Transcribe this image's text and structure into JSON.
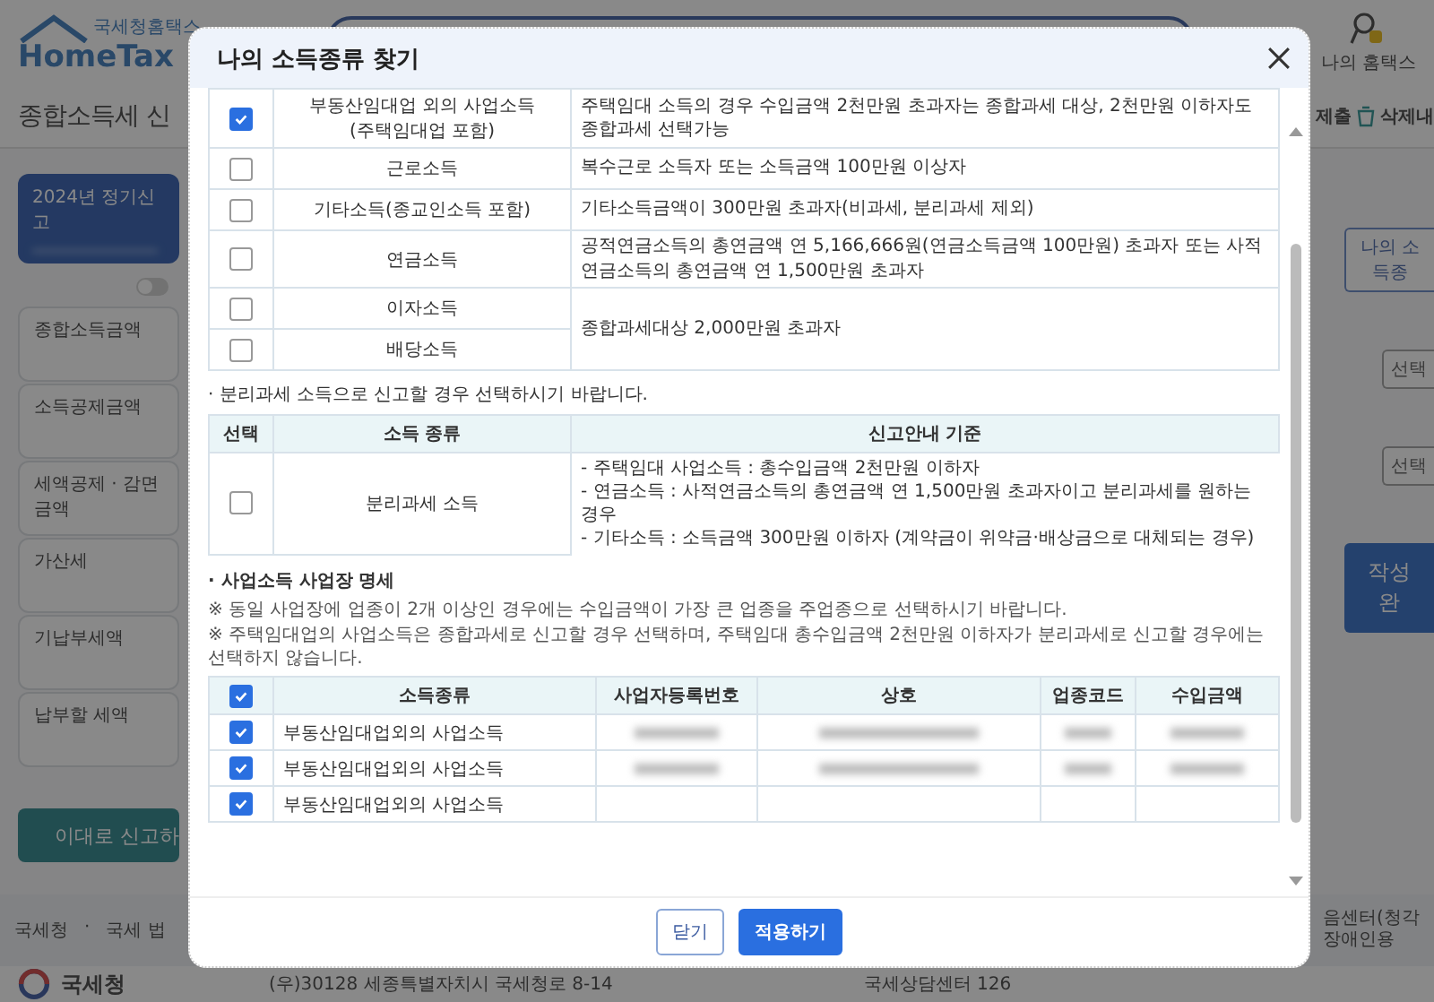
{
  "background_page": {
    "logo": {
      "small_text": "국세청홈택스",
      "brand": "HomeTax"
    },
    "user_menu": {
      "label": "나의 홈택스"
    },
    "page_title": "종합소득세 신",
    "toolbar": [
      "제출",
      "삭제내"
    ],
    "filing_card": {
      "label": "2024년 정기신고"
    },
    "toggle_on": false,
    "summary_items": [
      "종합소득금액",
      "소득공제금액",
      "세액공제 · 감면금액",
      "가산세",
      "기납부세액",
      "납부할 세액"
    ],
    "report_button": "이대로 신고하",
    "find_income_button": "나의 소득종",
    "select_buttons": [
      "선택",
      "선택"
    ],
    "complete_button": "작성완",
    "footer_links": [
      "국세청",
      "·",
      "국세 법"
    ],
    "footer_right": "음센터(청각장애인용",
    "address": "(우)30128 세종특별자치시 국세청로 8-14",
    "call_center": "국세상담센터 126",
    "agency_logo": "국세청"
  },
  "modal": {
    "title": "나의 소득종류 찾기",
    "income_groups": [
      {
        "description": "주택임대 소득의 경우 수입금액 2천만원 초과자는 종합과세 대상, 2천만원 이하자도 종합과세 선택가능",
        "items": [
          {
            "type": "부동산임대업 외의 사업소득\n(주택임대업 포함)",
            "checked": true
          }
        ]
      },
      {
        "description": "복수근로 소득자 또는 소득금액 100만원 이상자",
        "items": [
          {
            "type": "근로소득",
            "checked": false
          }
        ]
      },
      {
        "description": "기타소득금액이 300만원 초과자(비과세, 분리과세 제외)",
        "items": [
          {
            "type": "기타소득(종교인소득 포함)",
            "checked": false
          }
        ]
      },
      {
        "description": "공적연금소득의 총연금액 연 5,166,666원(연금소득금액 100만원) 초과자 또는 사적연금소득의 총연금액 연 1,500만원 초과자",
        "items": [
          {
            "type": "연금소득",
            "checked": false
          }
        ]
      },
      {
        "description": "종합과세대상 2,000만원 초과자",
        "items": [
          {
            "type": "이자소득",
            "checked": false
          },
          {
            "type": "배당소득",
            "checked": false
          }
        ]
      }
    ],
    "separate_note": "· 분리과세 소득으로 신고할 경우 선택하시기 바랍니다.",
    "separate_table": {
      "columns": [
        "선택",
        "소득 종류",
        "신고안내 기준"
      ],
      "rows": [
        {
          "checked": false,
          "type": "분리과세 소득",
          "criteria": [
            "- 주택임대 사업소득 : 총수입금액 2천만원 이하자",
            "- 연금소득 : 사적연금소득의 총연금액 연 1,500만원 초과자이고 분리과세를 원하는 경우",
            "- 기타소득 : 소득금액 300만원 이하자 (계약금이 위약금·배상금으로 대체되는 경우)"
          ]
        }
      ]
    },
    "business_heading": "· 사업소득 사업장 명세",
    "business_notes": [
      "※ 동일 사업장에 업종이 2개 이상인 경우에는 수입금액이 가장 큰 업종을 주업종으로 선택하시기 바랍니다.",
      "※ 주택임대업의 사업소득은 종합과세로 신고할 경우 선택하며, 주택임대 총수입금액 2천만원 이하자가 분리과세로 신고할 경우에는 선택하지 않습니다."
    ],
    "business_table": {
      "all_checked": true,
      "columns": [
        "소득종류",
        "사업자등록번호",
        "상호",
        "업종코드",
        "수입금액"
      ],
      "rows": [
        {
          "checked": true,
          "type": "부동산임대업외의 사업소득",
          "redacted": true
        },
        {
          "checked": true,
          "type": "부동산임대업외의 사업소득",
          "redacted": true
        },
        {
          "checked": true,
          "type": "부동산임대업외의 사업소득",
          "redacted": false
        }
      ]
    },
    "buttons": [
      {
        "label": "닫기",
        "kind": "secondary"
      },
      {
        "label": "적용하기",
        "kind": "primary"
      }
    ]
  }
}
